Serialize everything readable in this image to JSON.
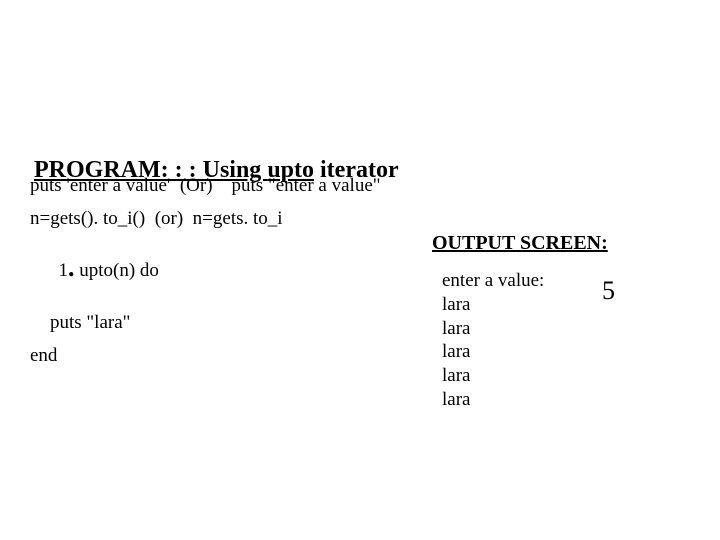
{
  "heading": {
    "prefix": "PROGRAM: : : Using ",
    "keyword": "upto",
    "suffix": " iterator"
  },
  "code": {
    "line1": "puts 'enter a value'  (Or)    puts \"enter a value\"",
    "line2": "n=gets(). to_i()  (or)  n=gets. to_i",
    "line3_pre": "1",
    "line3_dot": ".",
    "line3_post": " upto(n) do",
    "line4": "puts \"lara\"",
    "line5": "end"
  },
  "output": {
    "title": "OUTPUT SCREEN:",
    "prompt": "enter a value:",
    "input": "5",
    "lines": [
      "lara",
      "lara",
      "lara",
      "lara",
      "lara"
    ]
  }
}
